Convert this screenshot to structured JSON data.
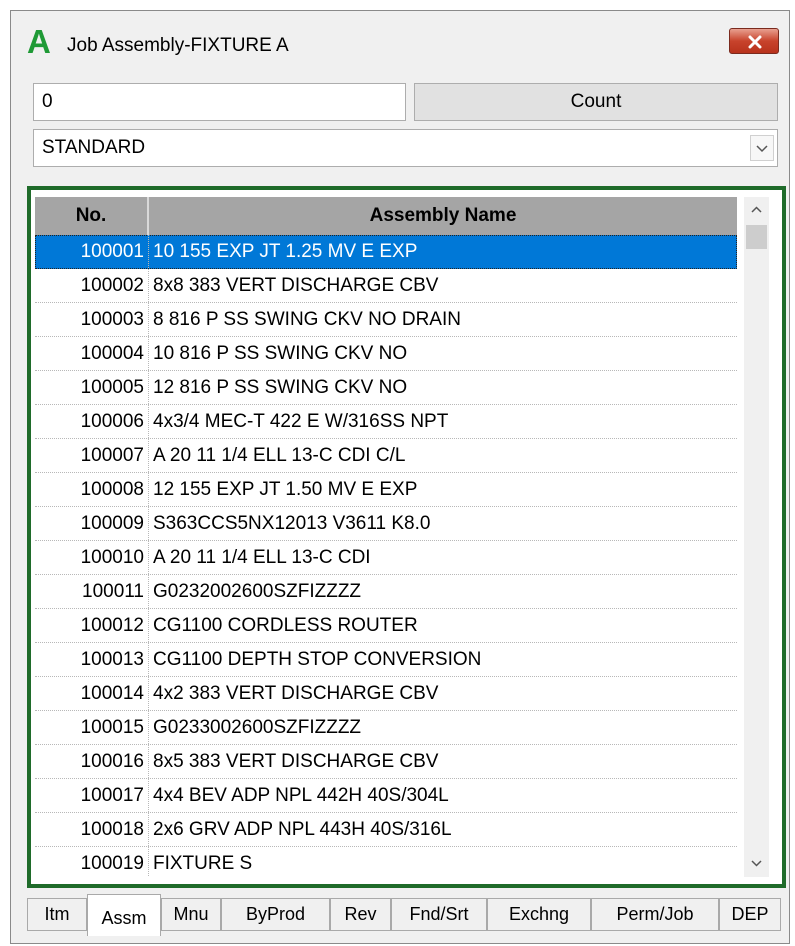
{
  "window": {
    "title": "Job Assembly-FIXTURE  A",
    "logo": "A"
  },
  "toolbar": {
    "count_value": "0",
    "count_label": "Count"
  },
  "combo": {
    "value": "STANDARD"
  },
  "grid": {
    "headers": {
      "no": "No.",
      "name": "Assembly Name"
    },
    "selected_index": 0,
    "rows": [
      {
        "no": "100001",
        "name": "10 155 EXP JT 1.25 MV E EXP"
      },
      {
        "no": "100002",
        "name": "8x8 383 VERT DISCHARGE CBV"
      },
      {
        "no": "100003",
        "name": "8 816 P SS SWING CKV NO DRAIN"
      },
      {
        "no": "100004",
        "name": "10 816 P SS SWING CKV NO"
      },
      {
        "no": "100005",
        "name": "12 816 P SS SWING CKV NO"
      },
      {
        "no": "100006",
        "name": "4x3/4 MEC-T 422 E W/316SS NPT"
      },
      {
        "no": "100007",
        "name": "A 20 11 1/4 ELL 13-C CDI C/L"
      },
      {
        "no": "100008",
        "name": "12 155 EXP JT 1.50 MV E EXP"
      },
      {
        "no": "100009",
        "name": "S363CCS5NX12013 V3611 K8.0"
      },
      {
        "no": "100010",
        "name": "A 20 11 1/4 ELL 13-C CDI"
      },
      {
        "no": "100011",
        "name": "G0232002600SZFIZZZZ"
      },
      {
        "no": "100012",
        "name": "CG1100 CORDLESS ROUTER"
      },
      {
        "no": "100013",
        "name": "CG1100 DEPTH STOP CONVERSION"
      },
      {
        "no": "100014",
        "name": "4x2 383 VERT DISCHARGE CBV"
      },
      {
        "no": "100015",
        "name": "G0233002600SZFIZZZZ"
      },
      {
        "no": "100016",
        "name": "8x5 383 VERT DISCHARGE CBV"
      },
      {
        "no": "100017",
        "name": "4x4 BEV ADP NPL 442H 40S/304L"
      },
      {
        "no": "100018",
        "name": "2x6 GRV ADP NPL 443H 40S/316L"
      },
      {
        "no": "100019",
        "name": "FIXTURE  S"
      }
    ]
  },
  "tabs": [
    {
      "label": "Itm"
    },
    {
      "label": "Assm",
      "active": true
    },
    {
      "label": "Mnu"
    },
    {
      "label": "ByProd"
    },
    {
      "label": "Rev"
    },
    {
      "label": "Fnd/Srt"
    },
    {
      "label": "Exchng"
    },
    {
      "label": "Perm/Job"
    },
    {
      "label": "DEP"
    }
  ],
  "colors": {
    "selection": "#0078d7",
    "frame": "#1f6b2a",
    "header": "#a5a5a5",
    "logo": "#1f9a36",
    "close": "#c8432c"
  }
}
